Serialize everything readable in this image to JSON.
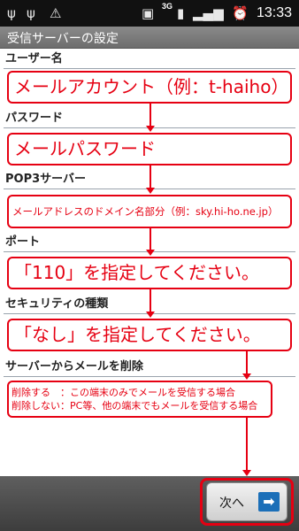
{
  "status_bar": {
    "time": "13:33",
    "network": "3G"
  },
  "title": "受信サーバーの設定",
  "sections": [
    {
      "label": "ユーザー名",
      "value": "メールアカウント（例：t-haiho）"
    },
    {
      "label": "パスワード",
      "value": "メールパスワード"
    },
    {
      "label": "POP3サーバー",
      "value": "メールアドレスのドメイン名部分（例：sky.hi-ho.ne.jp）"
    },
    {
      "label": "ポート",
      "value": "「110」を指定してください。"
    },
    {
      "label": "セキュリティの種類",
      "value": "「なし」を指定してください。"
    },
    {
      "label": "サーバーからメールを削除",
      "lines": [
        "削除する　：この端末のみでメールを受信する場合",
        "削除しない：PC等、他の端末でもメールを受信する場合"
      ]
    }
  ],
  "next_button": {
    "label": "次へ"
  },
  "colors": {
    "annotation_red": "#e60012",
    "titlebar": "#7a7a7a",
    "button_arrow": "#1b6fb8"
  }
}
